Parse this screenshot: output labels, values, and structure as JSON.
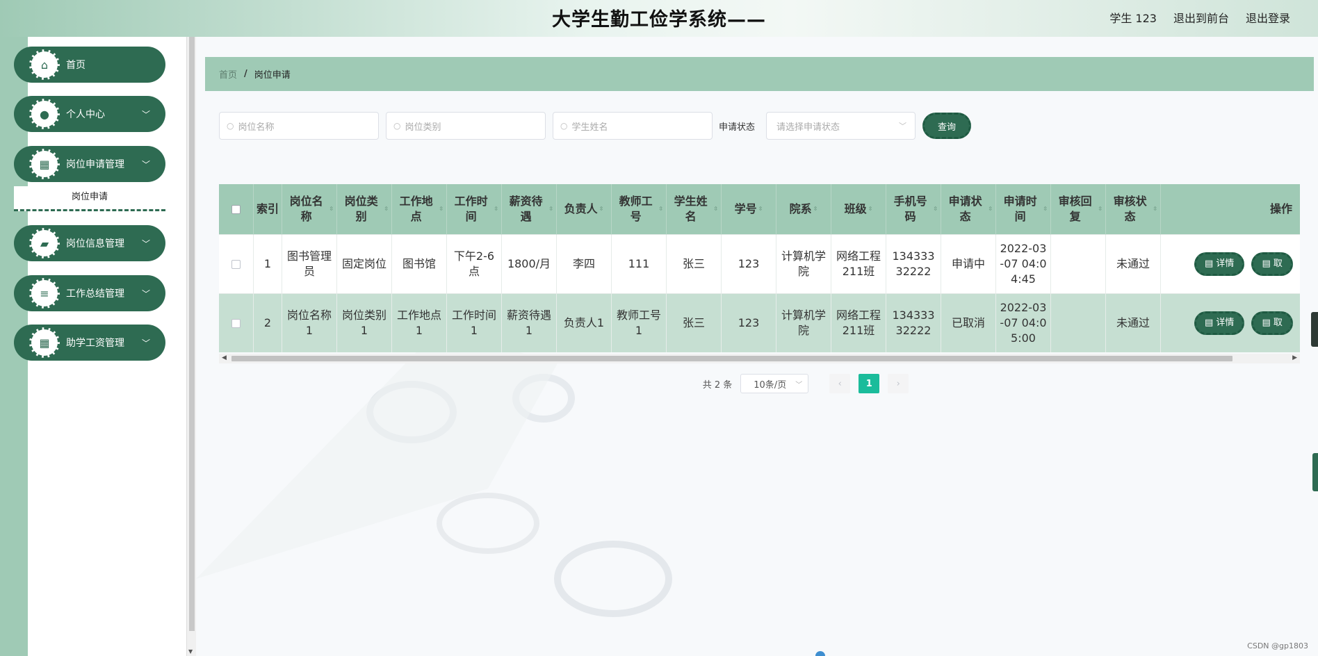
{
  "header": {
    "title": "大学生勤工俭学系统——",
    "user": "学生 123",
    "back_to_front": "退出到前台",
    "logout": "退出登录"
  },
  "sidebar": {
    "items": [
      {
        "label": "首页",
        "icon": "home-icon"
      },
      {
        "label": "个人中心",
        "icon": "user-icon"
      },
      {
        "label": "岗位申请管理",
        "icon": "grid-icon"
      },
      {
        "label": "岗位信息管理",
        "icon": "briefcase-icon"
      },
      {
        "label": "工作总结管理",
        "icon": "list-icon"
      },
      {
        "label": "助学工资管理",
        "icon": "grid-icon"
      }
    ],
    "submenu_active": "岗位申请"
  },
  "breadcrumb": {
    "home": "首页",
    "separator": "/",
    "current": "岗位申请"
  },
  "search": {
    "job_name_placeholder": "岗位名称",
    "job_type_placeholder": "岗位类别",
    "student_name_placeholder": "学生姓名",
    "status_label": "申请状态",
    "status_placeholder": "请选择申请状态",
    "query_button": "查询"
  },
  "table": {
    "columns": [
      "索引",
      "岗位名称",
      "岗位类别",
      "工作地点",
      "工作时间",
      "薪资待遇",
      "负责人",
      "教师工号",
      "学生姓名",
      "学号",
      "院系",
      "班级",
      "手机号码",
      "申请状态",
      "申请时间",
      "审核回复",
      "审核状态",
      "操作"
    ],
    "rows": [
      {
        "index": "1",
        "job_name": "图书管理员",
        "job_type": "固定岗位",
        "location": "图书馆",
        "work_time": "下午2-6点",
        "salary": "1800/月",
        "manager": "李四",
        "teacher_id": "111",
        "student_name": "张三",
        "student_id": "123",
        "department": "计算机学院",
        "class": "网络工程211班",
        "phone": "13433332222",
        "apply_status": "申请中",
        "apply_time": "2022-03-07 04:04:45",
        "review_reply": "",
        "review_status": "未通过"
      },
      {
        "index": "2",
        "job_name": "岗位名称1",
        "job_type": "岗位类别1",
        "location": "工作地点1",
        "work_time": "工作时间1",
        "salary": "薪资待遇1",
        "manager": "负责人1",
        "teacher_id": "教师工号1",
        "student_name": "张三",
        "student_id": "123",
        "department": "计算机学院",
        "class": "网络工程211班",
        "phone": "13433332222",
        "apply_status": "已取消",
        "apply_time": "2022-03-07 04:05:00",
        "review_reply": "",
        "review_status": "未通过"
      }
    ],
    "detail_button": "详情",
    "second_button_partial": "取"
  },
  "pagination": {
    "total": "共 2 条",
    "page_size": "10条/页",
    "current_page": "1"
  },
  "watermark": "CSDN @gp1803",
  "colors": {
    "primary": "#2e6b52",
    "header_bg": "#9fcab5",
    "row_alt": "#c6dfd2",
    "page_active": "#1bbc9b"
  }
}
